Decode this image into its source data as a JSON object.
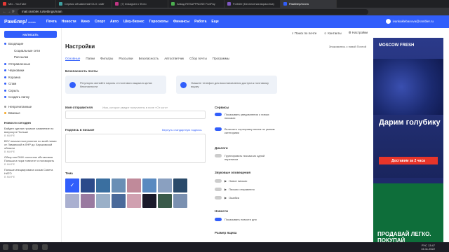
{
  "browser": {
    "tabs": [
      {
        "label": "Mix - YouTube",
        "color": "#e53935"
      },
      {
        "label": "Сервис объявлений OLX: сайт",
        "color": "#3fa0a0"
      },
      {
        "label": "(7) Instagram • Фото",
        "color": "#c13584"
      },
      {
        "label": "Завод RESAPPNOSE FunPay",
        "color": "#4caf50"
      },
      {
        "label": "Fortnite (Бесплатная вкрасотка)",
        "color": "#7e57c2"
      },
      {
        "label": "Рамблер/почта",
        "color": "#315efb"
      }
    ],
    "url": "mail.rambler.ru/settings/main"
  },
  "header": {
    "logo": "Рамблер/",
    "logo_sub": "почта",
    "nav": [
      "Почта",
      "Новости",
      "Кино",
      "Спорт",
      "Авто",
      "Шоу-бизнес",
      "Гороскопы",
      "Финансы",
      "Работа",
      "Еще"
    ],
    "user": "ivankaklebanova@rambler.ru"
  },
  "sidebar": {
    "write_label": "НАПИСАТЬ",
    "folders": [
      "Входящие",
      "Социальные сети",
      "Рассылки",
      "Отправленные",
      "Черновики",
      "Корзина",
      "Спам",
      "Скрыть",
      "Создать папку"
    ],
    "labels": [
      "Непрочитанные",
      "Важные"
    ],
    "news_caption": "Новости сегодня",
    "news": [
      {
        "text": "Байден сделал громкое заявление по вопросу в Польше",
        "src": "В МИРЕ"
      },
      {
        "text": "ВСУ начали наступление по всей линии от Лиманской в ЛНР до Харьковской области",
        "src": "В МИРЕ"
      },
      {
        "text": "Обзор ингСМИ: холостая обстановка Польши и пора «свести» и поговорить",
        "src": "В МИРЕ"
      },
      {
        "text": "Польше инициировала созыв Совета НАТО",
        "src": "В МИРЕ"
      }
    ]
  },
  "toolbar": {
    "search": "Поиск по почте",
    "contacts": "Контакты",
    "settings": "Настройки"
  },
  "settings": {
    "title": "Настройки",
    "right_link": "Знакомьтесь с новой Почтой",
    "tabs": [
      "Основные",
      "Папки",
      "Фильтры",
      "Рассылки",
      "Безопасность",
      "Автоответчик",
      "Сбор почты",
      "Программы"
    ],
    "security_caption": "Безопасность почты",
    "cards": [
      "Регулярно меняйте пароль от почтового ящика в целях безопасности",
      "Укажите телефон для восстановления доступа к почтовому ящику"
    ],
    "sender_label": "Имя отправителя",
    "sender_hint": "Имя, которое увидит получатель в поле «От кого»",
    "signature_label": "Подпись в письме",
    "signature_link": "Вернуть стандартную подпись",
    "theme_label": "Тема",
    "services_caption": "Сервисы",
    "services": [
      "Показывать уведомления о новых письмах",
      "Включить сортировку писем по умным категориям"
    ],
    "dialogs_caption": "Диалоги",
    "dialogs": [
      "Группировать письма из одной переписки"
    ],
    "sounds_caption": "Звуковые оповещения",
    "sounds": [
      "Новое письмо",
      "Письмо отправлено",
      "Ошибка"
    ],
    "news_caption": "Новости",
    "news": [
      "Показывать новости дня"
    ],
    "size_caption": "Размер ящика"
  },
  "ad": {
    "brand": "MOSCOW FRESH",
    "headline": "Дарим голубику",
    "button": "Доставим за 2 часа",
    "headline2": "ПРОДАВАЙ ЛЕГКО. ПОКУПАЙ"
  },
  "taskbar": {
    "time": "13:47",
    "date": "16.11.2022",
    "lang": "РУС"
  },
  "colors": {
    "accent": "#315efb",
    "ad_red": "#e8352a"
  }
}
